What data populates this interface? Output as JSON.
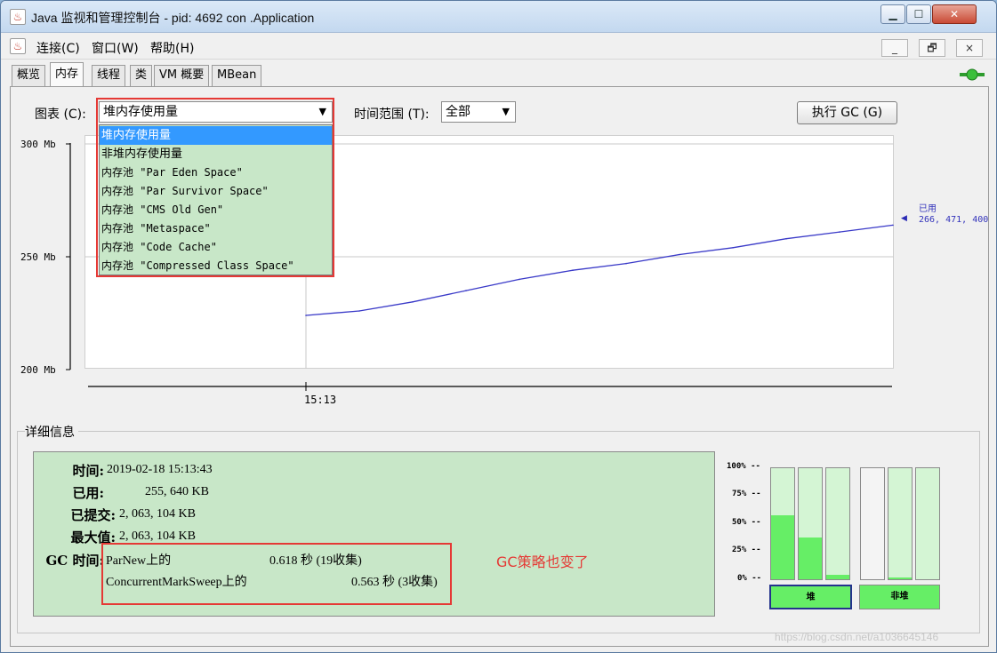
{
  "window": {
    "title": "Java 监视和管理控制台 - pid: 4692 con                       .Application",
    "app_icon": "java-cup-icon"
  },
  "menubar": {
    "items": [
      "连接(C)",
      "窗口(W)",
      "帮助(H)"
    ],
    "inner_buttons": [
      "_",
      "🗗",
      "×"
    ]
  },
  "tabs": [
    "概览",
    "内存",
    "线程",
    "类",
    "VM 概要",
    "MBean"
  ],
  "active_tab": "内存",
  "toolbar": {
    "chart_label": "图表 (C):",
    "chart_selected": "堆内存使用量",
    "time_range_label": "时间范围 (T):",
    "time_range_selected": "全部",
    "gc_button": "执行 GC (G)"
  },
  "dropdown": {
    "items": [
      "堆内存使用量",
      "非堆内存使用量",
      "内存池 \"Par Eden Space\"",
      "内存池 \"Par Survivor Space\"",
      "内存池 \"CMS Old Gen\"",
      "内存池 \"Metaspace\"",
      "内存池 \"Code Cache\"",
      "内存池 \"Compressed Class Space\""
    ],
    "selected_index": 0
  },
  "chart_data": {
    "type": "line",
    "y_ticks": [
      "300 Mb",
      "250 Mb",
      "200 Mb"
    ],
    "ylim_mb": [
      200,
      300
    ],
    "x_ticks": [
      "15:13"
    ],
    "series": [
      {
        "name": "已用",
        "values_mb": [
          224,
          226,
          230,
          235,
          240,
          244,
          247,
          251,
          254,
          258,
          261,
          264
        ]
      }
    ],
    "current_value_label": "266, 471, 400",
    "line_color": "#3a3ac8"
  },
  "details": {
    "title": "详细信息",
    "rows": [
      {
        "key": "时间:",
        "value": "2019-02-18 15:13:43"
      },
      {
        "key": "已用:",
        "value": "255, 640 KB"
      },
      {
        "key": "已提交:",
        "value": "2, 063, 104 KB"
      },
      {
        "key": "最大值:",
        "value": "2, 063, 104 KB"
      }
    ],
    "gc_key": "GC 时间:",
    "gc_rows": [
      {
        "name": "ParNew上的",
        "time": "0.618 秒 (19收集)"
      },
      {
        "name": "ConcurrentMarkSweep上的",
        "time": "0.563 秒 (3收集)"
      }
    ],
    "annotation": "GC策略也变了"
  },
  "pool_bars": {
    "pct_labels": [
      "100% --",
      "75% --",
      "50% --",
      "25% --",
      "0% --"
    ],
    "heap_fill_pct": [
      58,
      38,
      4
    ],
    "nonheap_fill_pct": [
      0,
      2,
      0
    ],
    "heap_button": "堆",
    "nonheap_button": "非堆"
  },
  "watermark": "https://blog.csdn.net/a1036645146"
}
